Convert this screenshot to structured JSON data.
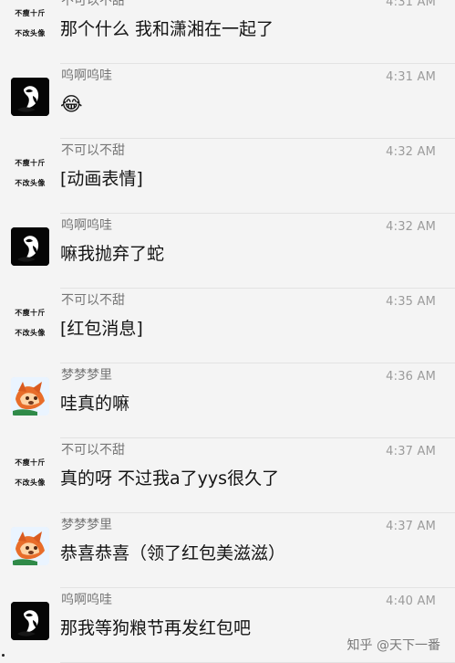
{
  "messages": [
    {
      "sender": "不可以不甜",
      "time": "4:31 AM",
      "content": "那个什么 我和潇湘在一起了",
      "avatar_lines": [
        "不瘦十斤",
        "不改头像"
      ]
    },
    {
      "sender": "呜啊呜哇",
      "time": "4:31 AM",
      "content": "😂",
      "avatar_type": "dark-figure"
    },
    {
      "sender": "不可以不甜",
      "time": "4:32 AM",
      "content": "[动画表情]",
      "avatar_lines": [
        "不瘦十斤",
        "不改头像"
      ]
    },
    {
      "sender": "呜啊呜哇",
      "time": "4:32 AM",
      "content": "嘛我抛弃了蛇",
      "avatar_type": "dark-figure"
    },
    {
      "sender": "不可以不甜",
      "time": "4:35 AM",
      "content": "[红包消息]",
      "avatar_lines": [
        "不瘦十斤",
        "不改头像"
      ]
    },
    {
      "sender": "梦梦梦里",
      "time": "4:36 AM",
      "content": "哇真的嘛",
      "avatar_type": "fox"
    },
    {
      "sender": "不可以不甜",
      "time": "4:37 AM",
      "content": "真的呀 不过我a了yys很久了",
      "avatar_lines": [
        "不瘦十斤",
        "不改头像"
      ]
    },
    {
      "sender": "梦梦梦里",
      "time": "4:37 AM",
      "content": "恭喜恭喜（领了红包美滋滋）",
      "avatar_type": "fox"
    },
    {
      "sender": "呜啊呜哇",
      "time": "4:40 AM",
      "content": "那我等狗粮节再发红包吧",
      "avatar_type": "dark-figure"
    }
  ],
  "watermark": "知乎 @天下一番"
}
